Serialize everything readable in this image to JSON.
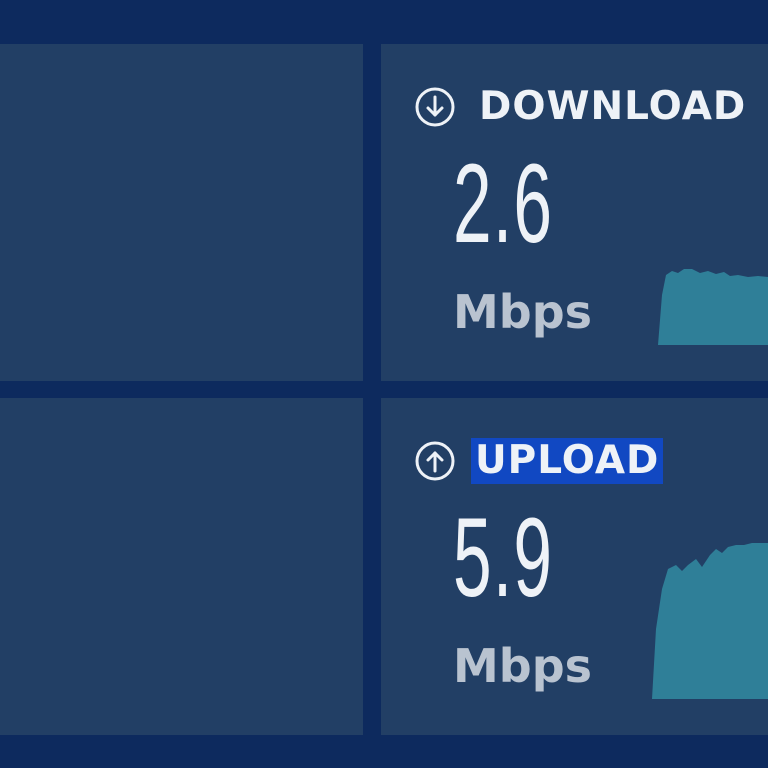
{
  "download": {
    "label": "DOWNLOAD",
    "value": "2.6",
    "unit": "Mbps",
    "icon": "arrow-down-circle-icon"
  },
  "upload": {
    "label": "UPLOAD",
    "value": "5.9",
    "unit": "Mbps",
    "icon": "arrow-up-circle-icon",
    "label_selected": true
  },
  "colors": {
    "background": "#0d2a5e",
    "panel": "#223f65",
    "text": "#eef2f7",
    "unit_text": "#b9c3d0",
    "graph_fill": "#2f7f98",
    "selection": "#1148c2"
  }
}
